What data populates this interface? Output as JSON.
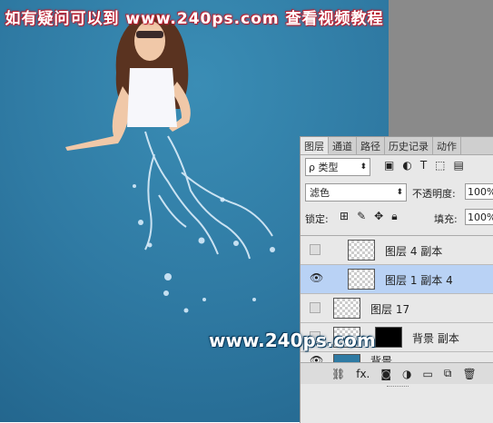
{
  "banner": {
    "text": "如有疑问可以到  www.240ps.com  查看视频教程"
  },
  "watermark": {
    "text": "www.240ps.com"
  },
  "panel": {
    "tabs": [
      {
        "label": "图层"
      },
      {
        "label": "通道"
      },
      {
        "label": "路径"
      },
      {
        "label": "历史记录"
      },
      {
        "label": "动作"
      }
    ],
    "filter": {
      "kind_label": "ρ 类型",
      "icons": [
        "image-filter-icon",
        "adjustment-filter-icon",
        "type-filter-icon",
        "shape-filter-icon",
        "smart-object-filter-icon"
      ]
    },
    "blend_mode": "滤色",
    "opacity_label": "不透明度:",
    "opacity_value": "100%",
    "lock_label": "锁定:",
    "fill_label": "填充:",
    "fill_value": "100%",
    "layers": [
      {
        "name": "图层 4 副本",
        "visible": false,
        "selected": false
      },
      {
        "name": "图层 1 副本 4",
        "visible": true,
        "selected": true
      },
      {
        "name": "图层 17",
        "visible": false,
        "selected": false
      },
      {
        "name": "背景 副本",
        "visible": false,
        "selected": false
      },
      {
        "name": "背景",
        "visible": true,
        "selected": false
      }
    ],
    "footer_icons": [
      "link-icon",
      "fx-icon",
      "mask-icon",
      "adjustment-icon",
      "folder-icon",
      "new-layer-icon",
      "trash-icon"
    ],
    "footer_fx": "fx."
  },
  "colors": {
    "canvas_blue": "#2f7aa3",
    "selected_row": "#b9d2f5",
    "banner_outline": "#b23333"
  }
}
